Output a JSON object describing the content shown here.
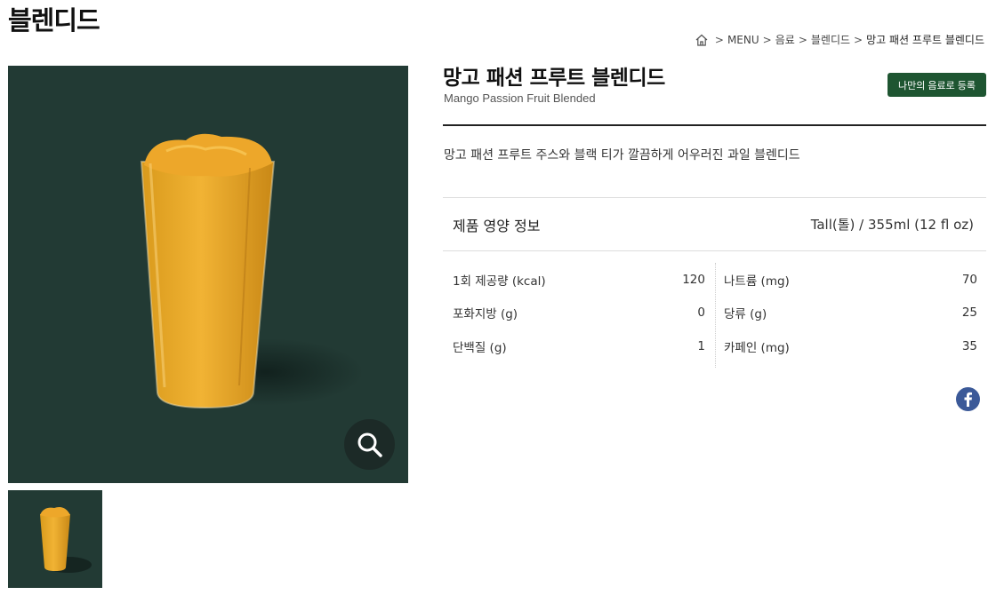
{
  "page": {
    "title": "블렌디드"
  },
  "breadcrumb": {
    "items": [
      "MENU",
      "음료",
      "블렌디드"
    ],
    "current": "망고 패션 프루트 블렌디드"
  },
  "product": {
    "name_ko": "망고 패션 프루트 블렌디드",
    "name_en": "Mango Passion Fruit Blended",
    "register_label": "나만의 음료로 등록",
    "description": "망고 패션 프루트 주스와 블랙 티가 깔끔하게 어우러진 과일 블렌디드"
  },
  "nutrition": {
    "title": "제품 영양 정보",
    "size": "Tall(톨) / 355ml (12 fl oz)",
    "left": [
      {
        "label": "1회 제공량 (kcal)",
        "value": "120"
      },
      {
        "label": "포화지방 (g)",
        "value": "0"
      },
      {
        "label": "단백질 (g)",
        "value": "1"
      }
    ],
    "right": [
      {
        "label": "나트륨 (mg)",
        "value": "70"
      },
      {
        "label": "당류 (g)",
        "value": "25"
      },
      {
        "label": "카페인 (mg)",
        "value": "35"
      }
    ]
  },
  "icons": {
    "home": "home-icon",
    "zoom": "magnifier-icon",
    "share": "facebook-icon"
  },
  "colors": {
    "image_bg": "#223a34",
    "register_button": "#1e5531",
    "facebook": "#3b5998"
  }
}
